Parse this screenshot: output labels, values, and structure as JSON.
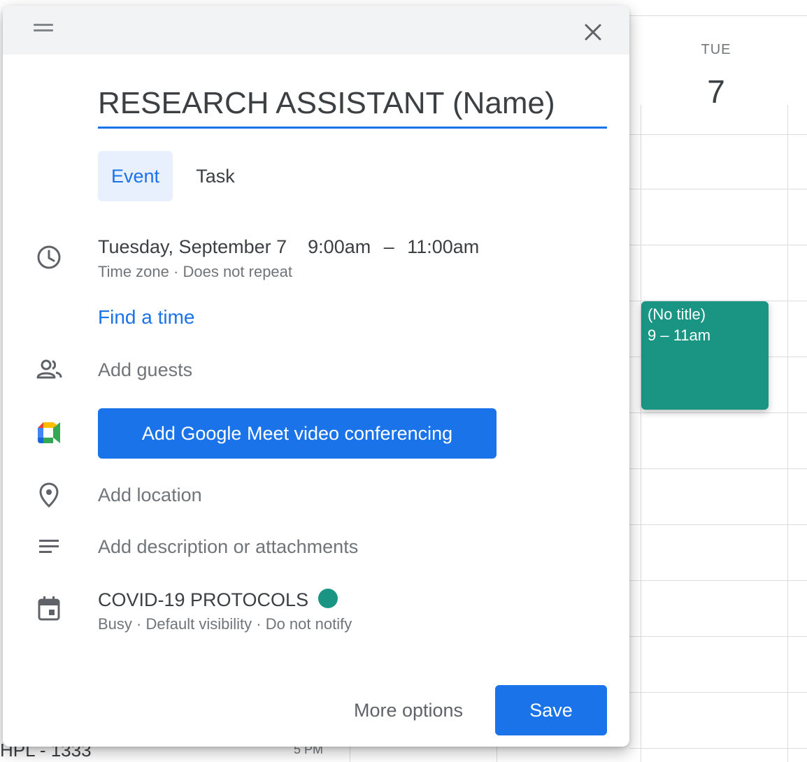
{
  "calendar": {
    "day_name": "TUE",
    "day_number": "7",
    "event_chip": {
      "title": "(No title)",
      "time": "9 – 11am",
      "color": "#1a9583"
    },
    "bottom_room_label": "HPL - 1333",
    "bottom_time_label": "5 PM"
  },
  "dialog": {
    "title_value": "RESEARCH ASSISTANT (Name)",
    "tabs": [
      {
        "label": "Event",
        "selected": true
      },
      {
        "label": "Task",
        "selected": false
      }
    ],
    "datetime": {
      "date": "Tuesday, September 7",
      "start": "9:00am",
      "separator": "–",
      "end": "11:00am",
      "timezone": "Time zone",
      "repeat": "Does not repeat",
      "dot": "·"
    },
    "find_time": "Find a time",
    "add_guests": "Add guests",
    "meet_button": "Add Google Meet video conferencing",
    "add_location": "Add location",
    "add_description": "Add description or attachments",
    "calendar_row": {
      "name": "COVID-19 PROTOCOLS",
      "color": "#1a9583",
      "busy": "Busy",
      "visibility": "Default visibility",
      "notify": "Do not notify",
      "dot": "·"
    },
    "more_options": "More options",
    "save": "Save"
  },
  "icons": [
    "drag-handle-icon",
    "close-icon",
    "clock-icon",
    "people-icon",
    "google-meet-icon",
    "location-pin-icon",
    "description-lines-icon",
    "calendar-icon"
  ],
  "colors": {
    "accent": "#1a73e8",
    "event_teal": "#1a9583",
    "selected_tab_bg": "#e8f0fe"
  }
}
